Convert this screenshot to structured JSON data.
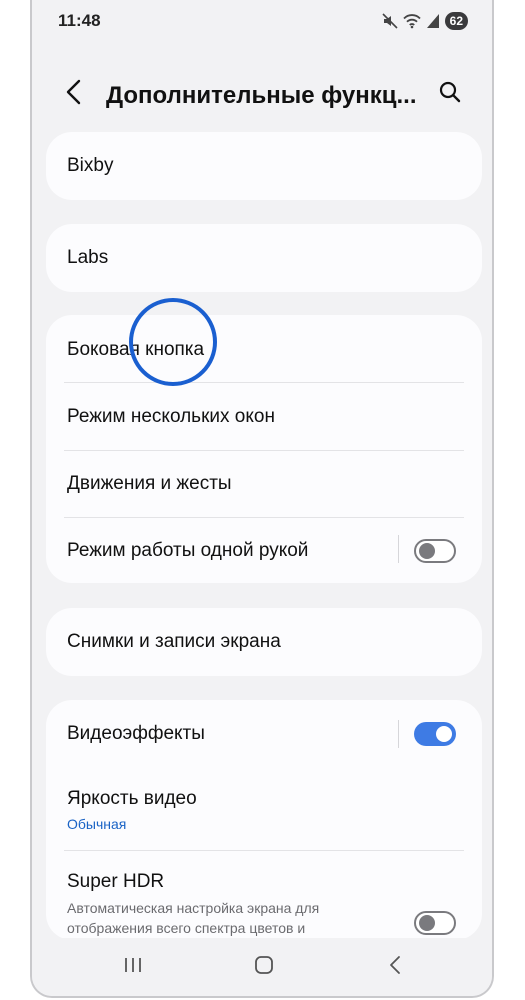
{
  "status_bar": {
    "time": "11:48",
    "battery": "62",
    "icons": [
      "mute-icon",
      "wifi-icon",
      "signal-icon"
    ]
  },
  "header": {
    "title": "Дополнительные функц...",
    "back_icon": "chevron-left-icon",
    "search_icon": "search-icon"
  },
  "cards": {
    "bixby": {
      "label": "Bixby"
    },
    "labs": {
      "label": "Labs"
    },
    "group1": {
      "side_button": "Боковая кнопка",
      "multi_window": "Режим нескольких окон",
      "motions": "Движения и жесты",
      "one_handed": "Режим работы одной рукой",
      "one_handed_enabled": false
    },
    "screenshots": {
      "label": "Снимки и записи экрана"
    },
    "group2": {
      "video_effects": "Видеоэффекты",
      "video_effects_enabled": true,
      "video_brightness": "Яркость видео",
      "video_brightness_value": "Обычная",
      "super_hdr": "Super HDR",
      "super_hdr_desc": "Автоматическая настройка экрана для отображения всего спектра цветов и",
      "super_hdr_enabled": false
    }
  },
  "nav_bar": {
    "recents_icon": "recents-icon",
    "home_icon": "home-icon",
    "back_icon": "back-icon"
  },
  "colors": {
    "accent": "#3e7be4",
    "link": "#1a63c5",
    "touch_indicator": "#1a5fd0",
    "background": "#f2f2f4",
    "card": "#fcfcfe"
  }
}
